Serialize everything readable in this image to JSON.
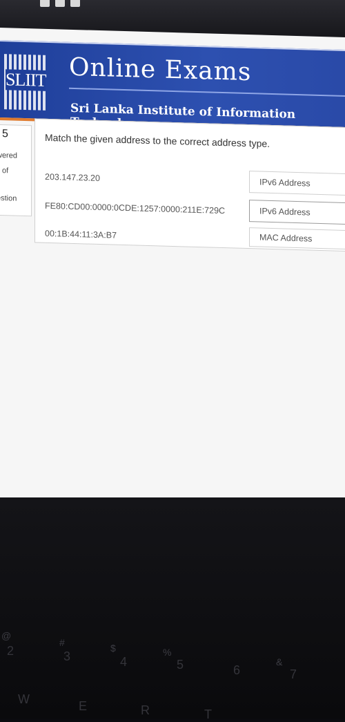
{
  "header": {
    "title": "Online Exams",
    "subtitle": "Sri Lanka Institute of Information Technology",
    "logo_text": "SLIIT"
  },
  "sidebar": {
    "count": "5",
    "items": [
      "wered",
      "of",
      "estion"
    ]
  },
  "question": {
    "prompt": "Match the given address to the correct address type.",
    "rows": [
      {
        "address": "203.147.23.20",
        "answer": "IPv6 Address"
      },
      {
        "address": "FE80:CD00:0000:0CDE:1257:0000:211E:729C",
        "answer": "IPv6 Address"
      },
      {
        "address": "00:1B:44:11:3A:B7",
        "answer": "MAC Address"
      }
    ]
  },
  "keyboard": {
    "number_row": [
      "@",
      "2",
      "#",
      "3",
      "$",
      "4",
      "%",
      "5",
      "6",
      "&",
      "7"
    ],
    "letter_row": [
      "W",
      "E",
      "R",
      "T"
    ]
  },
  "colors": {
    "header_blue": "#2a4aa8",
    "accent_orange": "#e07b2e",
    "page_bg": "#f6f6f6"
  }
}
